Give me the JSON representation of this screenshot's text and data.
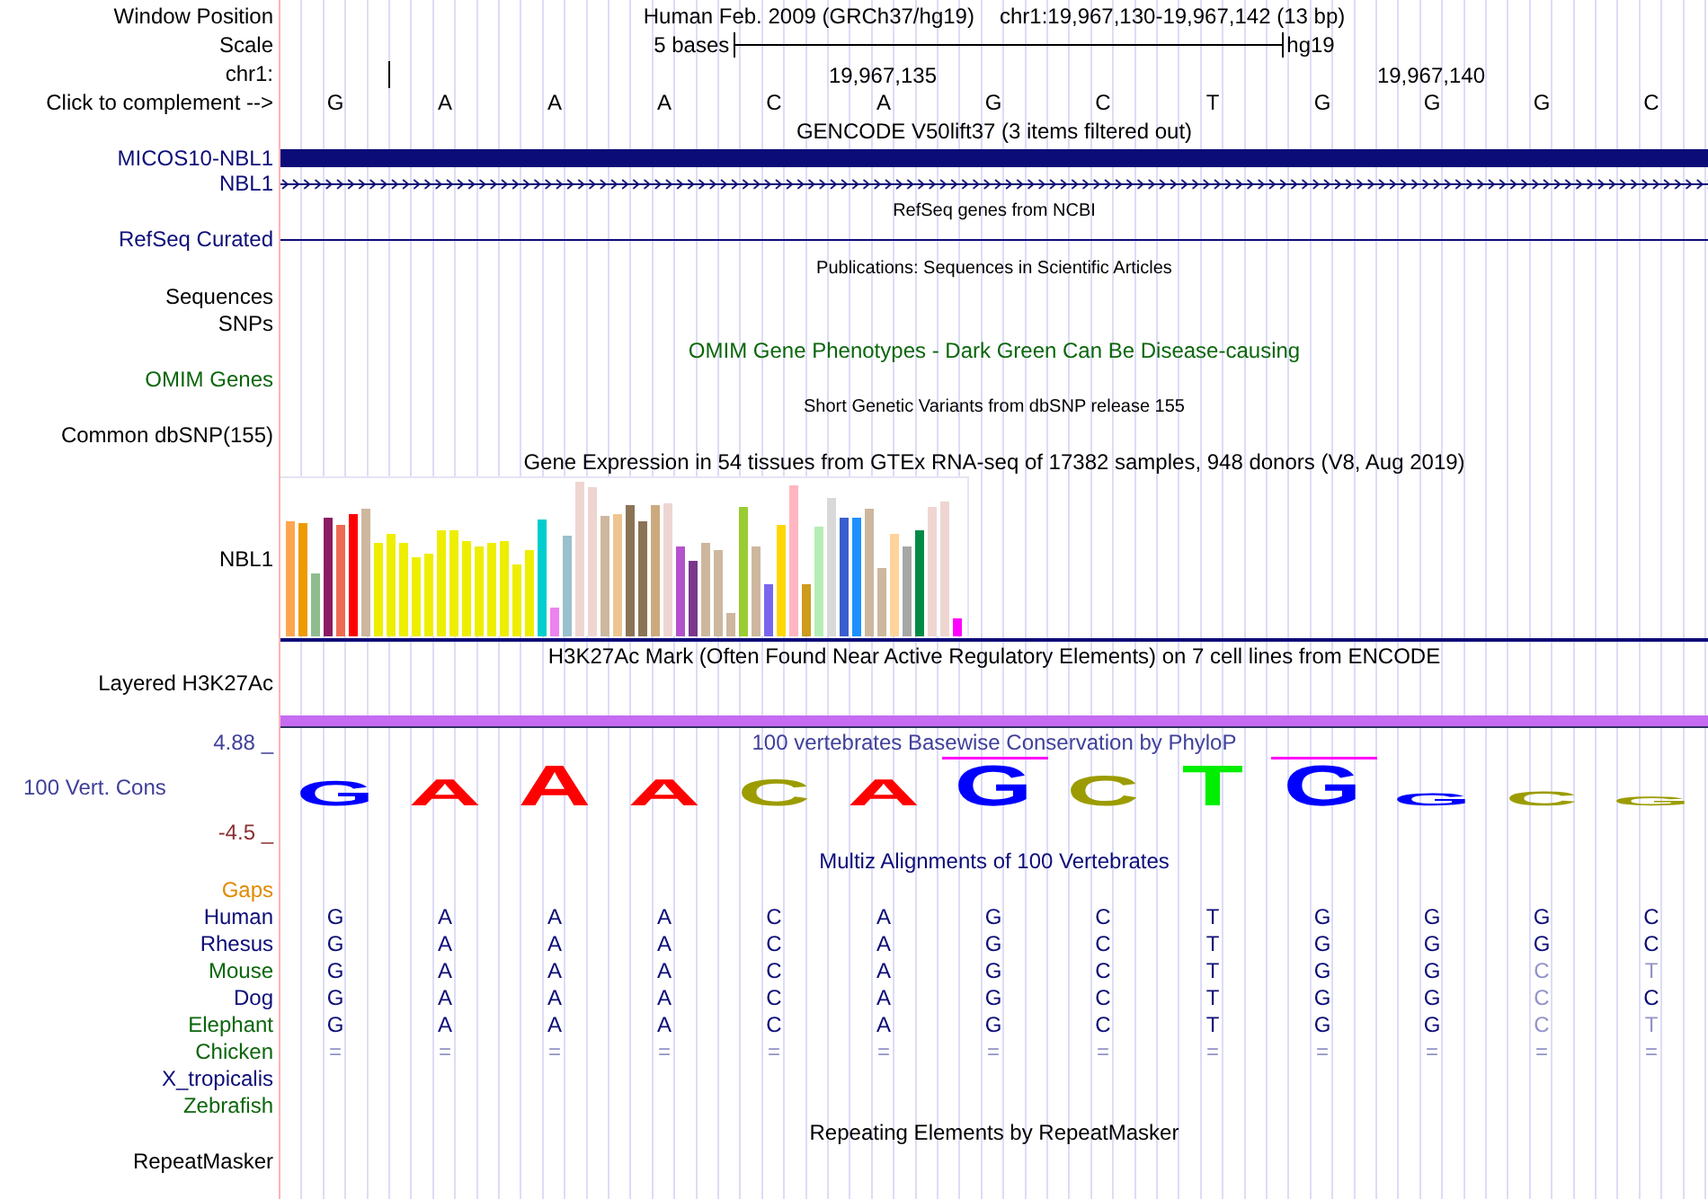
{
  "header": {
    "label": "Window Position",
    "title": "Human Feb. 2009 (GRCh37/hg19)",
    "position": "chr1:19,967,130-19,967,142 (13 bp)"
  },
  "scale": {
    "label": "Scale",
    "text": "5 bases",
    "assembly": "hg19"
  },
  "ruler": {
    "label": "chr1:",
    "tick_labels": [
      "19,967,135",
      "19,967,140"
    ]
  },
  "bases": {
    "label": "Click to complement -->",
    "letters": [
      "G",
      "A",
      "A",
      "A",
      "C",
      "A",
      "G",
      "C",
      "T",
      "G",
      "G",
      "G",
      "C"
    ]
  },
  "tracks": [
    {
      "kind": "title",
      "text": "GENCODE V50lift37 (3 items filtered out)",
      "color": "#000000",
      "small": false
    },
    {
      "kind": "gene_bar",
      "label": "MICOS10-NBL1",
      "color": "#0c0c78"
    },
    {
      "kind": "gene_arrows",
      "label": "NBL1",
      "color": "#0c0c78"
    },
    {
      "kind": "title",
      "text": "RefSeq genes from NCBI",
      "color": "#000000",
      "small": true
    },
    {
      "kind": "line",
      "label": "RefSeq Curated",
      "color": "#0c0c78"
    },
    {
      "kind": "title",
      "text": "Publications: Sequences in Scientific Articles",
      "color": "#000000",
      "small": true
    },
    {
      "kind": "label",
      "label": "Sequences",
      "color": "#000000"
    },
    {
      "kind": "label",
      "label": "SNPs",
      "color": "#000000"
    },
    {
      "kind": "title",
      "text": "OMIM Gene Phenotypes - Dark Green Can Be Disease-causing",
      "color": "#0b660b",
      "small": false
    },
    {
      "kind": "label",
      "label": "OMIM Genes",
      "color": "#0b660b"
    },
    {
      "kind": "title",
      "text": "Short Genetic Variants from dbSNP release 155",
      "color": "#000000",
      "small": true
    },
    {
      "kind": "label",
      "label": "Common dbSNP(155)",
      "color": "#000000"
    },
    {
      "kind": "title",
      "text": "Gene Expression in 54 tissues from GTEx RNA-seq of 17382 samples, 948 donors (V8, Aug 2019)",
      "color": "#000000",
      "small": false
    },
    {
      "kind": "expression",
      "label": "NBL1",
      "color": "#000000"
    },
    {
      "kind": "title",
      "text": "H3K27Ac Mark (Often Found Near Active Regulatory Elements) on 7 cell lines from ENCODE",
      "color": "#000000",
      "small": false
    },
    {
      "kind": "signal",
      "label": "Layered H3K27Ac",
      "color": "#000000"
    },
    {
      "kind": "conservation",
      "label": "100 Vert. Cons",
      "color": "#40409a",
      "max": "4.88 _",
      "min": "-4.5 _",
      "title": "100 vertebrates Basewise Conservation by PhyloP",
      "letters": [
        {
          "text": "G",
          "color": "#0000ff",
          "marked": false
        },
        {
          "text": "A",
          "color": "#ff0000",
          "marked": false
        },
        {
          "text": "A",
          "color": "#ff0000",
          "marked": false
        },
        {
          "text": "A",
          "color": "#ff0000",
          "marked": false
        },
        {
          "text": "C",
          "color": "#9c9c00",
          "marked": false
        },
        {
          "text": "A",
          "color": "#ff0000",
          "marked": false
        },
        {
          "text": "G",
          "color": "#0000ff",
          "marked": true
        },
        {
          "text": "C",
          "color": "#9c9c00",
          "marked": false
        },
        {
          "text": "T",
          "color": "#00ee00",
          "marked": false
        },
        {
          "text": "G",
          "color": "#0000ff",
          "marked": true
        },
        {
          "text": "G",
          "color": "#0000ff",
          "marked": false
        },
        {
          "text": "C",
          "color": "#9c9c00",
          "marked": false
        },
        {
          "text": "G",
          "color": "#9c9c00",
          "marked": false
        }
      ]
    },
    {
      "kind": "title",
      "text": "Multiz Alignments of 100 Vertebrates",
      "color": "#0c0c78",
      "small": false
    },
    {
      "kind": "label",
      "label": "Gaps",
      "color": "#e08a00"
    },
    {
      "kind": "alignment",
      "label": "Human",
      "color": "#0c0c78",
      "bases": [
        {
          "text": "G",
          "faded": false
        },
        {
          "text": "A",
          "faded": false
        },
        {
          "text": "A",
          "faded": false
        },
        {
          "text": "A",
          "faded": false
        },
        {
          "text": "C",
          "faded": false
        },
        {
          "text": "A",
          "faded": false
        },
        {
          "text": "G",
          "faded": false
        },
        {
          "text": "C",
          "faded": false
        },
        {
          "text": "T",
          "faded": false
        },
        {
          "text": "G",
          "faded": false
        },
        {
          "text": "G",
          "faded": false
        },
        {
          "text": "G",
          "faded": false
        },
        {
          "text": "C",
          "faded": false
        }
      ]
    },
    {
      "kind": "alignment",
      "label": "Rhesus",
      "color": "#0c0c78",
      "bases": [
        {
          "text": "G",
          "faded": false
        },
        {
          "text": "A",
          "faded": false
        },
        {
          "text": "A",
          "faded": false
        },
        {
          "text": "A",
          "faded": false
        },
        {
          "text": "C",
          "faded": false
        },
        {
          "text": "A",
          "faded": false
        },
        {
          "text": "G",
          "faded": false
        },
        {
          "text": "C",
          "faded": false
        },
        {
          "text": "T",
          "faded": false
        },
        {
          "text": "G",
          "faded": false
        },
        {
          "text": "G",
          "faded": false
        },
        {
          "text": "G",
          "faded": false
        },
        {
          "text": "C",
          "faded": false
        }
      ]
    },
    {
      "kind": "alignment",
      "label": "Mouse",
      "color": "#0b660b",
      "bases": [
        {
          "text": "G",
          "faded": false
        },
        {
          "text": "A",
          "faded": false
        },
        {
          "text": "A",
          "faded": false
        },
        {
          "text": "A",
          "faded": false
        },
        {
          "text": "C",
          "faded": false
        },
        {
          "text": "A",
          "faded": false
        },
        {
          "text": "G",
          "faded": false
        },
        {
          "text": "C",
          "faded": false
        },
        {
          "text": "T",
          "faded": false
        },
        {
          "text": "G",
          "faded": false
        },
        {
          "text": "G",
          "faded": false
        },
        {
          "text": "C",
          "faded": true
        },
        {
          "text": "T",
          "faded": true
        }
      ]
    },
    {
      "kind": "alignment",
      "label": "Dog",
      "color": "#0c0c78",
      "bases": [
        {
          "text": "G",
          "faded": false
        },
        {
          "text": "A",
          "faded": false
        },
        {
          "text": "A",
          "faded": false
        },
        {
          "text": "A",
          "faded": false
        },
        {
          "text": "C",
          "faded": false
        },
        {
          "text": "A",
          "faded": false
        },
        {
          "text": "G",
          "faded": false
        },
        {
          "text": "C",
          "faded": false
        },
        {
          "text": "T",
          "faded": false
        },
        {
          "text": "G",
          "faded": false
        },
        {
          "text": "G",
          "faded": false
        },
        {
          "text": "C",
          "faded": true
        },
        {
          "text": "C",
          "faded": false
        }
      ]
    },
    {
      "kind": "alignment",
      "label": "Elephant",
      "color": "#0b660b",
      "bases": [
        {
          "text": "G",
          "faded": false
        },
        {
          "text": "A",
          "faded": false
        },
        {
          "text": "A",
          "faded": false
        },
        {
          "text": "A",
          "faded": false
        },
        {
          "text": "C",
          "faded": false
        },
        {
          "text": "A",
          "faded": false
        },
        {
          "text": "G",
          "faded": false
        },
        {
          "text": "C",
          "faded": false
        },
        {
          "text": "T",
          "faded": false
        },
        {
          "text": "G",
          "faded": false
        },
        {
          "text": "G",
          "faded": false
        },
        {
          "text": "C",
          "faded": true
        },
        {
          "text": "T",
          "faded": true
        }
      ]
    },
    {
      "kind": "alignment",
      "label": "Chicken",
      "color": "#0b660b",
      "bases": [
        {
          "text": "=",
          "faded": true
        },
        {
          "text": "=",
          "faded": true
        },
        {
          "text": "=",
          "faded": true
        },
        {
          "text": "=",
          "faded": true
        },
        {
          "text": "=",
          "faded": true
        },
        {
          "text": "=",
          "faded": true
        },
        {
          "text": "=",
          "faded": true
        },
        {
          "text": "=",
          "faded": true
        },
        {
          "text": "=",
          "faded": true
        },
        {
          "text": "=",
          "faded": true
        },
        {
          "text": "=",
          "faded": true
        },
        {
          "text": "=",
          "faded": true
        },
        {
          "text": "=",
          "faded": true
        }
      ]
    },
    {
      "kind": "label",
      "label": "X_tropicalis",
      "color": "#0c0c78"
    },
    {
      "kind": "label",
      "label": "Zebrafish",
      "color": "#0b660b"
    },
    {
      "kind": "title",
      "text": "Repeating Elements by RepeatMasker",
      "color": "#000000",
      "small": false
    },
    {
      "kind": "label",
      "label": "RepeatMasker",
      "color": "#000000"
    }
  ]
}
